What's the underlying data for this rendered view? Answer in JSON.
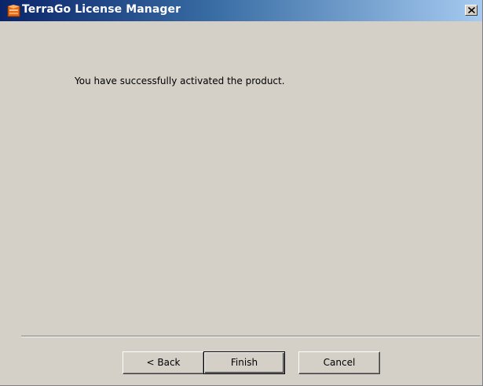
{
  "window": {
    "title": "TerraGo License Manager",
    "icon": "terrago-app-icon",
    "close_icon": "close-icon"
  },
  "content": {
    "message": "You have successfully activated the product."
  },
  "buttons": {
    "back_label": "< Back",
    "finish_label": "Finish",
    "cancel_label": "Cancel"
  },
  "colors": {
    "dialog_background": "#d4d0c8",
    "titlebar_start": "#0a246a",
    "titlebar_end": "#a6caf0",
    "icon_orange": "#f07a1a"
  }
}
